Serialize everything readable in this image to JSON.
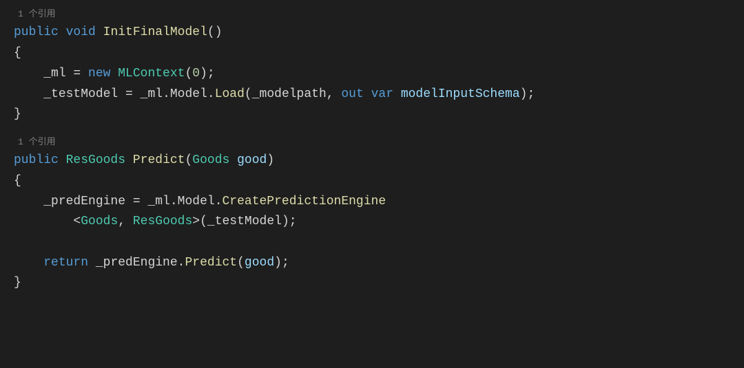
{
  "method1": {
    "codelens": "1 个引用",
    "access": "public",
    "returnType": "void",
    "name": "InitFinalModel",
    "openParen": "(",
    "closeParenSemi": ")",
    "openBrace": "{",
    "closeBrace": "}",
    "line1": {
      "field": "_ml",
      "equals": " = ",
      "newKw": "new",
      "ctor": "MLContext",
      "args": "(0);",
      "argNum": "0",
      "argOpen": "(",
      "argClose": ");"
    },
    "line2": {
      "field": "_testModel",
      "equals": " = ",
      "mlField": "_ml",
      "dot": ".",
      "modelProp": "Model",
      "loadMethod": "Load",
      "open": "(",
      "arg1": "_modelpath",
      "comma": ", ",
      "outKw": "out",
      "varKw": "var",
      "arg2": "modelInputSchema",
      "close": ");"
    }
  },
  "method2": {
    "codelens": "1 个引用",
    "access": "public",
    "returnType": "ResGoods",
    "name": "Predict",
    "param": {
      "type": "Goods",
      "name": "good"
    },
    "openBrace": "{",
    "closeBrace": "}",
    "line1": {
      "field": "_predEngine",
      "equals": " = ",
      "mlField": "_ml",
      "dot": ".",
      "modelProp": "Model",
      "method": "CreatePredictionEngine"
    },
    "line2": {
      "lt": "<",
      "t1": "Goods",
      "comma": ", ",
      "t2": "ResGoods",
      "gt": ">",
      "open": "(",
      "arg": "_testModel",
      "close": ");"
    },
    "line3": {
      "returnKw": "return",
      "field": "_predEngine",
      "dot": ".",
      "method": "Predict",
      "open": "(",
      "arg": "good",
      "close": ");"
    }
  }
}
